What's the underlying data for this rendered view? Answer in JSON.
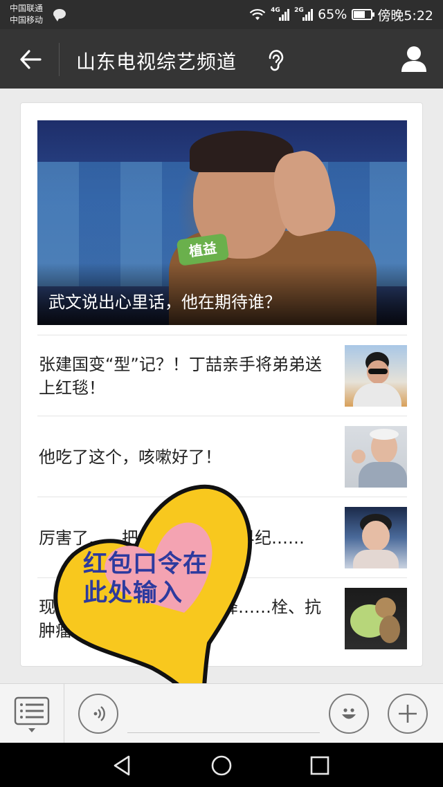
{
  "status_bar": {
    "carrier_1": "中国联通",
    "carrier_2": "中国移动",
    "network_1": "4G",
    "network_2": "2G",
    "battery": "65%",
    "battery_level": 0.65,
    "time": "傍晚5:22"
  },
  "navbar": {
    "title": "山东电视综艺频道",
    "back_icon": "arrow-left-icon",
    "listen_icon": "ear-icon",
    "profile_icon": "person-icon"
  },
  "article": {
    "hero_caption": "武文说出心里话，他在期待谁？",
    "hero_mic_label": "植益",
    "items": [
      {
        "title": "张建国变“型”记？！丁喆亲手将弟弟送上红毯！"
      },
      {
        "title": "他吃了这个，咳嗽好了！"
      },
      {
        "title": "厉害了……把气……破了世界纪……"
      },
      {
        "title": "现在……季第一菜是它，降……栓、抗肿瘤..."
      }
    ]
  },
  "overlay": {
    "line_1": "红包口令在",
    "line_2": "此处输入"
  },
  "input_bar": {
    "menu_icon": "list-menu-icon",
    "voice_icon": "voice-icon",
    "emoji_icon": "emoji-icon",
    "plus_icon": "plus-icon"
  },
  "colors": {
    "status_bg": "#2e2e2e",
    "nav_bg": "#353535",
    "page_bg": "#ebebeb",
    "heart_yellow": "#f8c81e",
    "heart_pink": "#f4a3b2",
    "overlay_text": "#2d3a9e"
  }
}
